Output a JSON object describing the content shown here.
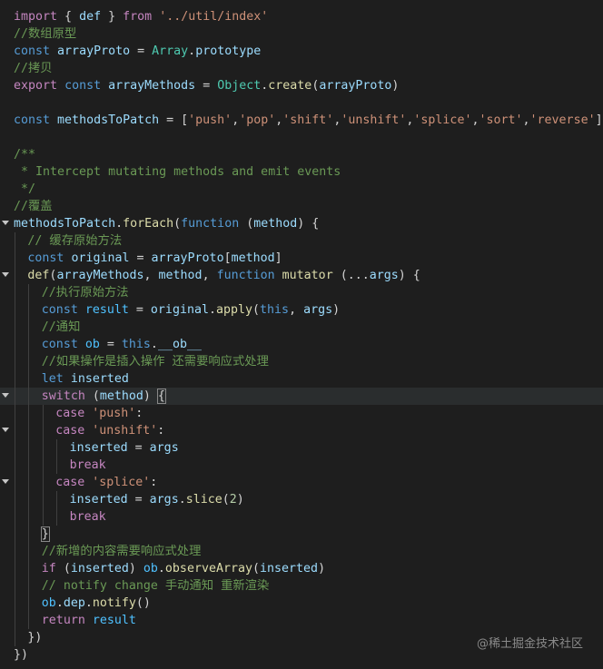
{
  "code": {
    "lines": [
      {
        "indent": 0,
        "tokens": [
          [
            "kw-ctl",
            "import"
          ],
          [
            "pl",
            " { "
          ],
          [
            "var",
            "def"
          ],
          [
            "pl",
            " } "
          ],
          [
            "kw-ctl",
            "from"
          ],
          [
            "pl",
            " "
          ],
          [
            "str",
            "'../util/index'"
          ]
        ]
      },
      {
        "indent": 0,
        "tokens": [
          [
            "cm",
            "//数组原型"
          ]
        ]
      },
      {
        "indent": 0,
        "tokens": [
          [
            "kw",
            "const"
          ],
          [
            "pl",
            " "
          ],
          [
            "var",
            "arrayProto"
          ],
          [
            "pl",
            " = "
          ],
          [
            "cls",
            "Array"
          ],
          [
            "pl",
            "."
          ],
          [
            "var",
            "prototype"
          ]
        ]
      },
      {
        "indent": 0,
        "tokens": [
          [
            "cm",
            "//拷贝"
          ]
        ]
      },
      {
        "indent": 0,
        "tokens": [
          [
            "kw-ctl",
            "export"
          ],
          [
            "pl",
            " "
          ],
          [
            "kw",
            "const"
          ],
          [
            "pl",
            " "
          ],
          [
            "var",
            "arrayMethods"
          ],
          [
            "pl",
            " = "
          ],
          [
            "cls",
            "Object"
          ],
          [
            "pl",
            "."
          ],
          [
            "fn",
            "create"
          ],
          [
            "pl",
            "("
          ],
          [
            "var",
            "arrayProto"
          ],
          [
            "pl",
            ")"
          ]
        ]
      },
      {
        "indent": 0,
        "tokens": []
      },
      {
        "indent": 0,
        "tokens": [
          [
            "kw",
            "const"
          ],
          [
            "pl",
            " "
          ],
          [
            "var",
            "methodsToPatch"
          ],
          [
            "pl",
            " = ["
          ],
          [
            "str",
            "'push'"
          ],
          [
            "pl",
            ","
          ],
          [
            "str",
            "'pop'"
          ],
          [
            "pl",
            ","
          ],
          [
            "str",
            "'shift'"
          ],
          [
            "pl",
            ","
          ],
          [
            "str",
            "'unshift'"
          ],
          [
            "pl",
            ","
          ],
          [
            "str",
            "'splice'"
          ],
          [
            "pl",
            ","
          ],
          [
            "str",
            "'sort'"
          ],
          [
            "pl",
            ","
          ],
          [
            "str",
            "'reverse'"
          ],
          [
            "pl",
            "]"
          ]
        ]
      },
      {
        "indent": 0,
        "tokens": []
      },
      {
        "indent": 0,
        "tokens": [
          [
            "cm",
            "/**"
          ]
        ]
      },
      {
        "indent": 0,
        "tokens": [
          [
            "cm",
            " * Intercept mutating methods and emit events"
          ]
        ]
      },
      {
        "indent": 0,
        "tokens": [
          [
            "cm",
            " */"
          ]
        ]
      },
      {
        "indent": 0,
        "tokens": [
          [
            "cm",
            "//覆盖"
          ]
        ]
      },
      {
        "indent": 0,
        "fold": true,
        "tokens": [
          [
            "var",
            "methodsToPatch"
          ],
          [
            "pl",
            "."
          ],
          [
            "fn",
            "forEach"
          ],
          [
            "pl",
            "("
          ],
          [
            "kw",
            "function"
          ],
          [
            "pl",
            " ("
          ],
          [
            "var",
            "method"
          ],
          [
            "pl",
            ") {"
          ]
        ]
      },
      {
        "indent": 1,
        "tokens": [
          [
            "cm",
            "// 缓存原始方法"
          ]
        ]
      },
      {
        "indent": 1,
        "tokens": [
          [
            "kw",
            "const"
          ],
          [
            "pl",
            " "
          ],
          [
            "var",
            "original"
          ],
          [
            "pl",
            " = "
          ],
          [
            "var",
            "arrayProto"
          ],
          [
            "pl",
            "["
          ],
          [
            "var",
            "method"
          ],
          [
            "pl",
            "]"
          ]
        ]
      },
      {
        "indent": 1,
        "fold": true,
        "tokens": [
          [
            "fn",
            "def"
          ],
          [
            "pl",
            "("
          ],
          [
            "var",
            "arrayMethods"
          ],
          [
            "pl",
            ", "
          ],
          [
            "var",
            "method"
          ],
          [
            "pl",
            ", "
          ],
          [
            "kw",
            "function"
          ],
          [
            "pl",
            " "
          ],
          [
            "fn",
            "mutator"
          ],
          [
            "pl",
            " (..."
          ],
          [
            "var",
            "args"
          ],
          [
            "pl",
            ") {"
          ]
        ]
      },
      {
        "indent": 2,
        "tokens": [
          [
            "cm",
            "//执行原始方法"
          ]
        ]
      },
      {
        "indent": 2,
        "tokens": [
          [
            "kw",
            "const"
          ],
          [
            "pl",
            " "
          ],
          [
            "const",
            "result"
          ],
          [
            "pl",
            " = "
          ],
          [
            "var",
            "original"
          ],
          [
            "pl",
            "."
          ],
          [
            "fn",
            "apply"
          ],
          [
            "pl",
            "("
          ],
          [
            "kw",
            "this"
          ],
          [
            "pl",
            ", "
          ],
          [
            "var",
            "args"
          ],
          [
            "pl",
            ")"
          ]
        ]
      },
      {
        "indent": 2,
        "tokens": [
          [
            "cm",
            "//通知"
          ]
        ]
      },
      {
        "indent": 2,
        "tokens": [
          [
            "kw",
            "const"
          ],
          [
            "pl",
            " "
          ],
          [
            "const",
            "ob"
          ],
          [
            "pl",
            " = "
          ],
          [
            "kw",
            "this"
          ],
          [
            "pl",
            "."
          ],
          [
            "var",
            "__ob__"
          ]
        ]
      },
      {
        "indent": 2,
        "tokens": [
          [
            "cm",
            "//如果操作是插入操作 还需要响应式处理"
          ]
        ]
      },
      {
        "indent": 2,
        "tokens": [
          [
            "kw",
            "let"
          ],
          [
            "pl",
            " "
          ],
          [
            "var",
            "inserted"
          ]
        ]
      },
      {
        "indent": 2,
        "fold": true,
        "hl": true,
        "tokens": [
          [
            "kw-ctl",
            "switch"
          ],
          [
            "pl",
            " ("
          ],
          [
            "var",
            "method"
          ],
          [
            "pl",
            ") "
          ],
          [
            "br",
            "{"
          ]
        ]
      },
      {
        "indent": 3,
        "tokens": [
          [
            "kw-ctl",
            "case"
          ],
          [
            "pl",
            " "
          ],
          [
            "str",
            "'push'"
          ],
          [
            "pl",
            ":"
          ]
        ]
      },
      {
        "indent": 3,
        "fold": true,
        "tokens": [
          [
            "kw-ctl",
            "case"
          ],
          [
            "pl",
            " "
          ],
          [
            "str",
            "'unshift'"
          ],
          [
            "pl",
            ":"
          ]
        ]
      },
      {
        "indent": 4,
        "tokens": [
          [
            "var",
            "inserted"
          ],
          [
            "pl",
            " = "
          ],
          [
            "var",
            "args"
          ]
        ]
      },
      {
        "indent": 4,
        "tokens": [
          [
            "kw-ctl",
            "break"
          ]
        ]
      },
      {
        "indent": 3,
        "fold": true,
        "tokens": [
          [
            "kw-ctl",
            "case"
          ],
          [
            "pl",
            " "
          ],
          [
            "str",
            "'splice'"
          ],
          [
            "pl",
            ":"
          ]
        ]
      },
      {
        "indent": 4,
        "tokens": [
          [
            "var",
            "inserted"
          ],
          [
            "pl",
            " = "
          ],
          [
            "var",
            "args"
          ],
          [
            "pl",
            "."
          ],
          [
            "fn",
            "slice"
          ],
          [
            "pl",
            "("
          ],
          [
            "num",
            "2"
          ],
          [
            "pl",
            ")"
          ]
        ]
      },
      {
        "indent": 4,
        "tokens": [
          [
            "kw-ctl",
            "break"
          ]
        ]
      },
      {
        "indent": 2,
        "tokens": [
          [
            "br",
            "}"
          ]
        ]
      },
      {
        "indent": 2,
        "tokens": [
          [
            "cm",
            "//新增的内容需要响应式处理"
          ]
        ]
      },
      {
        "indent": 2,
        "tokens": [
          [
            "kw-ctl",
            "if"
          ],
          [
            "pl",
            " ("
          ],
          [
            "var",
            "inserted"
          ],
          [
            "pl",
            ") "
          ],
          [
            "const",
            "ob"
          ],
          [
            "pl",
            "."
          ],
          [
            "fn",
            "observeArray"
          ],
          [
            "pl",
            "("
          ],
          [
            "var",
            "inserted"
          ],
          [
            "pl",
            ")"
          ]
        ]
      },
      {
        "indent": 2,
        "tokens": [
          [
            "cm",
            "// notify change 手动通知 重新渲染"
          ]
        ]
      },
      {
        "indent": 2,
        "tokens": [
          [
            "const",
            "ob"
          ],
          [
            "pl",
            "."
          ],
          [
            "var",
            "dep"
          ],
          [
            "pl",
            "."
          ],
          [
            "fn",
            "notify"
          ],
          [
            "pl",
            "()"
          ]
        ]
      },
      {
        "indent": 2,
        "tokens": [
          [
            "kw-ctl",
            "return"
          ],
          [
            "pl",
            " "
          ],
          [
            "const",
            "result"
          ]
        ]
      },
      {
        "indent": 1,
        "tokens": [
          [
            "pl",
            "})"
          ]
        ]
      },
      {
        "indent": 0,
        "tokens": [
          [
            "pl",
            "})"
          ]
        ]
      }
    ]
  },
  "watermark": "@稀土掘金技术社区",
  "colors": {
    "background": "#1e1e1e",
    "keyword": "#569cd6",
    "control": "#c586c0",
    "variable": "#9cdcfe",
    "constant": "#4fc1ff",
    "function": "#dcdcaa",
    "class": "#4ec9b0",
    "string": "#ce9178",
    "number": "#b5cea8",
    "comment": "#6a9955"
  }
}
